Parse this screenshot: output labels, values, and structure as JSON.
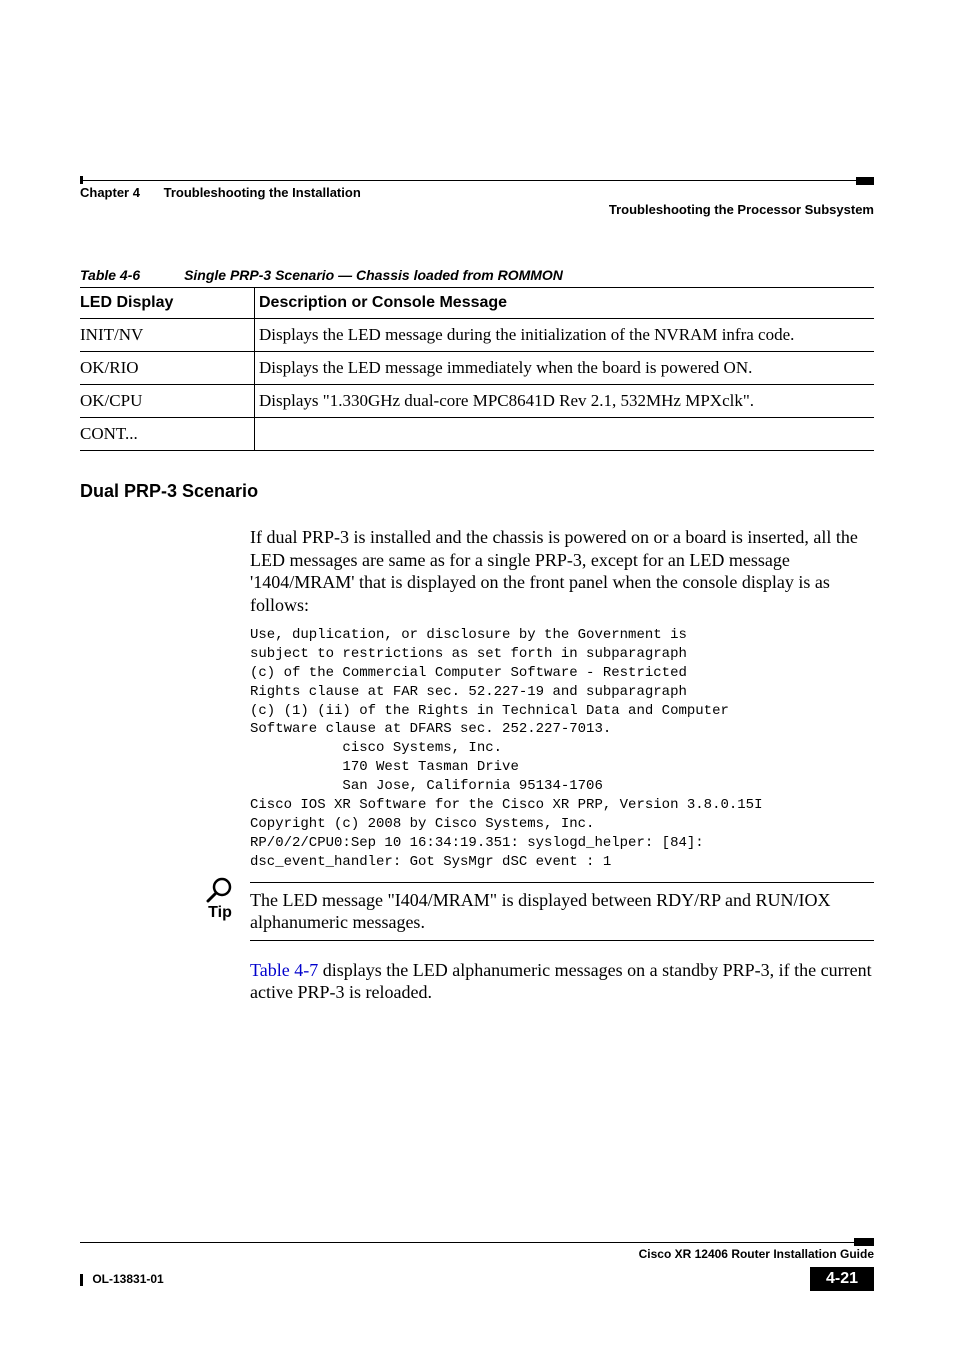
{
  "header": {
    "chapter_label": "Chapter 4",
    "chapter_title": "Troubleshooting the Installation",
    "section_title": "Troubleshooting the Processor Subsystem"
  },
  "table": {
    "number": "Table 4-6",
    "title": "Single PRP-3 Scenario — Chassis loaded from ROMMON",
    "headers": [
      "LED Display",
      "Description or Console Message"
    ],
    "rows": [
      {
        "c0": "INIT/NV",
        "c1": "Displays the LED message during the initialization of the NVRAM infra code."
      },
      {
        "c0": "OK/RIO",
        "c1": "Displays the LED message immediately when the board is powered ON."
      },
      {
        "c0": "OK/CPU",
        "c1": "Displays \"1.330GHz dual-core MPC8641D Rev 2.1, 532MHz MPXclk\"."
      },
      {
        "c0": "CONT...",
        "c1": ""
      }
    ]
  },
  "section_heading": "Dual PRP-3 Scenario",
  "para1": "If dual PRP-3 is installed and the chassis is powered on or a board is inserted, all the LED messages are same as for a single PRP-3, except for an LED message '1404/MRAM' that is displayed on the front panel when the console display is as follows:",
  "console": "Use, duplication, or disclosure by the Government is\nsubject to restrictions as set forth in subparagraph\n(c) of the Commercial Computer Software - Restricted\nRights clause at FAR sec. 52.227-19 and subparagraph\n(c) (1) (ii) of the Rights in Technical Data and Computer\nSoftware clause at DFARS sec. 252.227-7013.\n           cisco Systems, Inc.\n           170 West Tasman Drive\n           San Jose, California 95134-1706\nCisco IOS XR Software for the Cisco XR PRP, Version 3.8.0.15I\nCopyright (c) 2008 by Cisco Systems, Inc.\nRP/0/2/CPU0:Sep 10 16:34:19.351: syslogd_helper: [84]:\ndsc_event_handler: Got SysMgr dSC event : 1",
  "tip": {
    "label": "Tip",
    "text": "The LED message \"I404/MRAM\" is displayed between RDY/RP and RUN/IOX alphanumeric messages."
  },
  "para2_pre": " displays the LED alphanumeric messages on a standby PRP-3, if the current active PRP-3 is reloaded.",
  "para2_link": "Table 4-7",
  "footer": {
    "guide": "Cisco XR 12406 Router Installation Guide",
    "doc": "OL-13831-01",
    "page": "4-21"
  }
}
